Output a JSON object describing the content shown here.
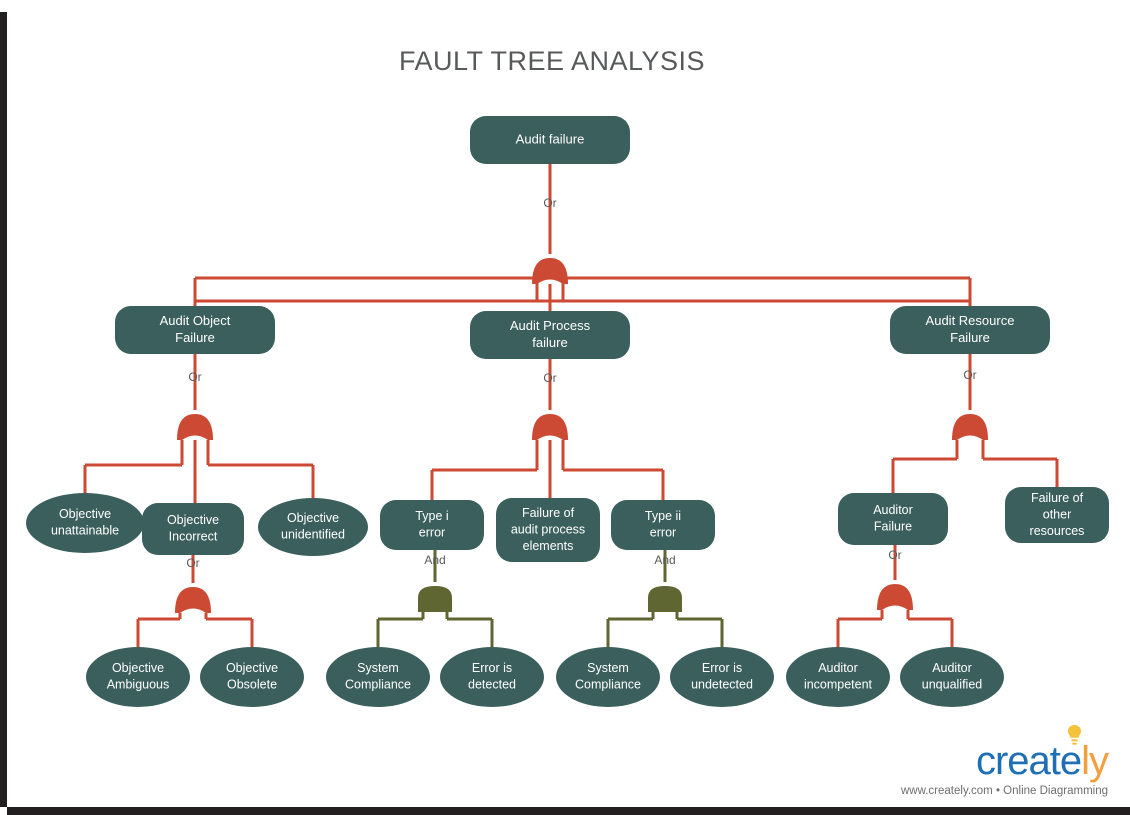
{
  "document": {
    "title": "FAULT TREE ANALYSIS"
  },
  "colors": {
    "node_fill": "#3a5f5c",
    "node_text": "#ffffff",
    "or_gate": "#cc4a33",
    "and_gate": "#5f6632",
    "title_text": "#58595b",
    "gate_label_text": "#58595b",
    "background": "#ffffff",
    "logo_blue": "#1f6fb5",
    "logo_orange": "#f2a03d"
  },
  "diagram": {
    "type": "fault-tree",
    "root": {
      "id": "audit-failure",
      "label": "Audit failure",
      "shape": "rounded-rect",
      "gate": "Or"
    },
    "nodes": [
      {
        "id": "audit-object-failure",
        "label": "Audit Object Failure",
        "shape": "rounded-rect",
        "gate": "Or",
        "level": 2,
        "parent": "audit-failure"
      },
      {
        "id": "audit-process-failure",
        "label": "Audit Process failure",
        "shape": "rounded-rect",
        "gate": "Or",
        "level": 2,
        "parent": "audit-failure"
      },
      {
        "id": "audit-resource-failure",
        "label": "Audit Resource Failure",
        "shape": "rounded-rect",
        "gate": "Or",
        "level": 2,
        "parent": "audit-failure"
      },
      {
        "id": "objective-unattainable",
        "label": "Objective unattainable",
        "shape": "ellipse",
        "gate": null,
        "level": 3,
        "parent": "audit-object-failure"
      },
      {
        "id": "objective-incorrect",
        "label": "Objective Incorrect",
        "shape": "rounded-rect",
        "gate": "Or",
        "level": 3,
        "parent": "audit-object-failure"
      },
      {
        "id": "objective-unidentified",
        "label": "Objective unidentified",
        "shape": "ellipse",
        "gate": null,
        "level": 3,
        "parent": "audit-object-failure"
      },
      {
        "id": "type-i-error",
        "label": "Type i error",
        "shape": "rounded-rect",
        "gate": "And",
        "level": 3,
        "parent": "audit-process-failure"
      },
      {
        "id": "failure-audit-process",
        "label": "Failure of audit process elements",
        "shape": "rounded-rect",
        "gate": null,
        "level": 3,
        "parent": "audit-process-failure"
      },
      {
        "id": "type-ii-error",
        "label": "Type ii error",
        "shape": "rounded-rect",
        "gate": "And",
        "level": 3,
        "parent": "audit-process-failure"
      },
      {
        "id": "auditor-failure",
        "label": "Auditor Failure",
        "shape": "rounded-rect",
        "gate": "Or",
        "level": 3,
        "parent": "audit-resource-failure"
      },
      {
        "id": "failure-other-resources",
        "label": "Failure of other resources",
        "shape": "rounded-rect",
        "gate": null,
        "level": 3,
        "parent": "audit-resource-failure"
      },
      {
        "id": "objective-ambiguous",
        "label": "Objective Ambiguous",
        "shape": "ellipse",
        "gate": null,
        "level": 4,
        "parent": "objective-incorrect"
      },
      {
        "id": "objective-obsolete",
        "label": "Objective Obsolete",
        "shape": "ellipse",
        "gate": null,
        "level": 4,
        "parent": "objective-incorrect"
      },
      {
        "id": "system-compliance-1",
        "label": "System Compliance",
        "shape": "ellipse",
        "gate": null,
        "level": 4,
        "parent": "type-i-error"
      },
      {
        "id": "error-is-detected",
        "label": "Error is detected",
        "shape": "ellipse",
        "gate": null,
        "level": 4,
        "parent": "type-i-error"
      },
      {
        "id": "system-compliance-2",
        "label": "System Compliance",
        "shape": "ellipse",
        "gate": null,
        "level": 4,
        "parent": "type-ii-error"
      },
      {
        "id": "error-is-undetected",
        "label": "Error is undetected",
        "shape": "ellipse",
        "gate": null,
        "level": 4,
        "parent": "type-ii-error"
      },
      {
        "id": "auditor-incompetent",
        "label": "Auditor incompetent",
        "shape": "ellipse",
        "gate": null,
        "level": 4,
        "parent": "auditor-failure"
      },
      {
        "id": "auditor-unqualified",
        "label": "Auditor unqualified",
        "shape": "ellipse",
        "gate": null,
        "level": 4,
        "parent": "auditor-failure"
      }
    ],
    "gate_labels": {
      "or": "Or",
      "and": "And"
    }
  },
  "footer": {
    "logo_part_1": "create",
    "logo_part_2": "ly",
    "tagline": "www.creately.com • Online Diagramming"
  }
}
